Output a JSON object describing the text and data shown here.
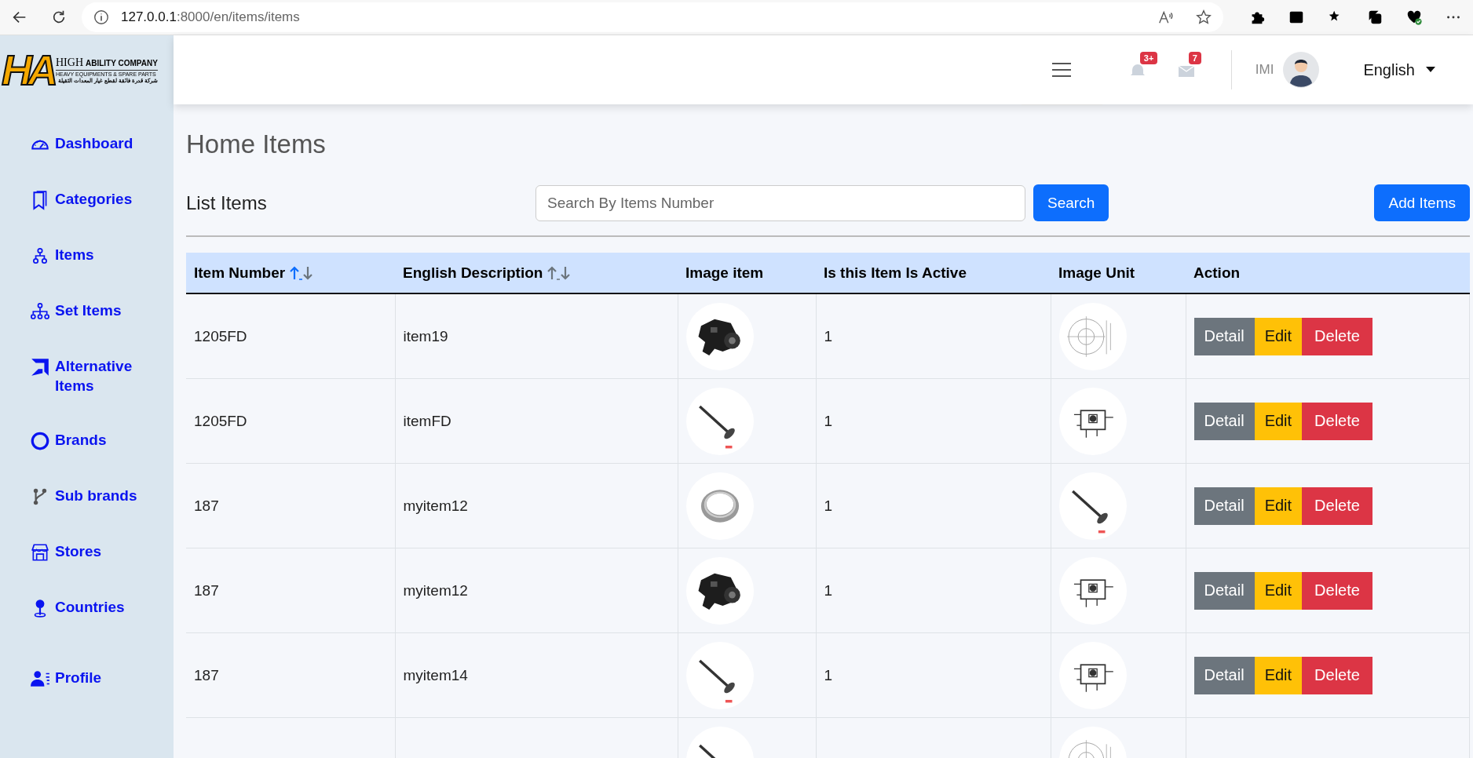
{
  "browser": {
    "url_host": "127.0.0.1",
    "url_rest": ":8000/en/items/items"
  },
  "logo": {
    "mark": "HA",
    "line_1a": "HIGH",
    "line_1b": "ABILITY COMPANY",
    "line_2": "HEAVY EQUIPMENTS & SPARE PARTS",
    "line_3": "شركة قدرة فائقة لقطع غيار المعدات الثقيلة"
  },
  "sidebar": {
    "items": [
      {
        "label": "Dashboard"
      },
      {
        "label": "Categories"
      },
      {
        "label": "Items"
      },
      {
        "label": "Set Items"
      },
      {
        "label": "Alternative Items"
      },
      {
        "label": "Brands"
      },
      {
        "label": "Sub brands"
      },
      {
        "label": "Stores"
      },
      {
        "label": "Countries"
      }
    ],
    "bottom_items": [
      {
        "label": "Profile"
      }
    ]
  },
  "header": {
    "notifications_badge": "3+",
    "messages_badge": "7",
    "user": "IMI",
    "language": "English"
  },
  "page_title": "Home Items",
  "toolbar": {
    "title": "List Items",
    "search_placeholder": "Search By Items Number",
    "search_button": "Search",
    "add_button": "Add Items"
  },
  "table": {
    "columns": [
      {
        "label": "Item Number",
        "sort_up_active": true
      },
      {
        "label": "English Description",
        "sort_up_active": false
      },
      {
        "label": "Image item"
      },
      {
        "label": "Is this Item Is Active"
      },
      {
        "label": "Image Unit"
      },
      {
        "label": "Action"
      }
    ],
    "rows": [
      {
        "item_number": "1205FD",
        "description": "item19",
        "active": "1",
        "actions": [
          "Detail",
          "Edit",
          "Delete"
        ]
      },
      {
        "item_number": "1205FD",
        "description": "itemFD",
        "active": "1",
        "actions": [
          "Detail",
          "Edit",
          "Delete"
        ]
      },
      {
        "item_number": "187",
        "description": "myitem12",
        "active": "1",
        "actions": [
          "Detail",
          "Edit",
          "Delete"
        ]
      },
      {
        "item_number": "187",
        "description": "myitem12",
        "active": "1",
        "actions": [
          "Detail",
          "Edit",
          "Delete"
        ]
      },
      {
        "item_number": "187",
        "description": "myitem14",
        "active": "1",
        "actions": [
          "Detail",
          "Edit",
          "Delete"
        ]
      }
    ]
  }
}
